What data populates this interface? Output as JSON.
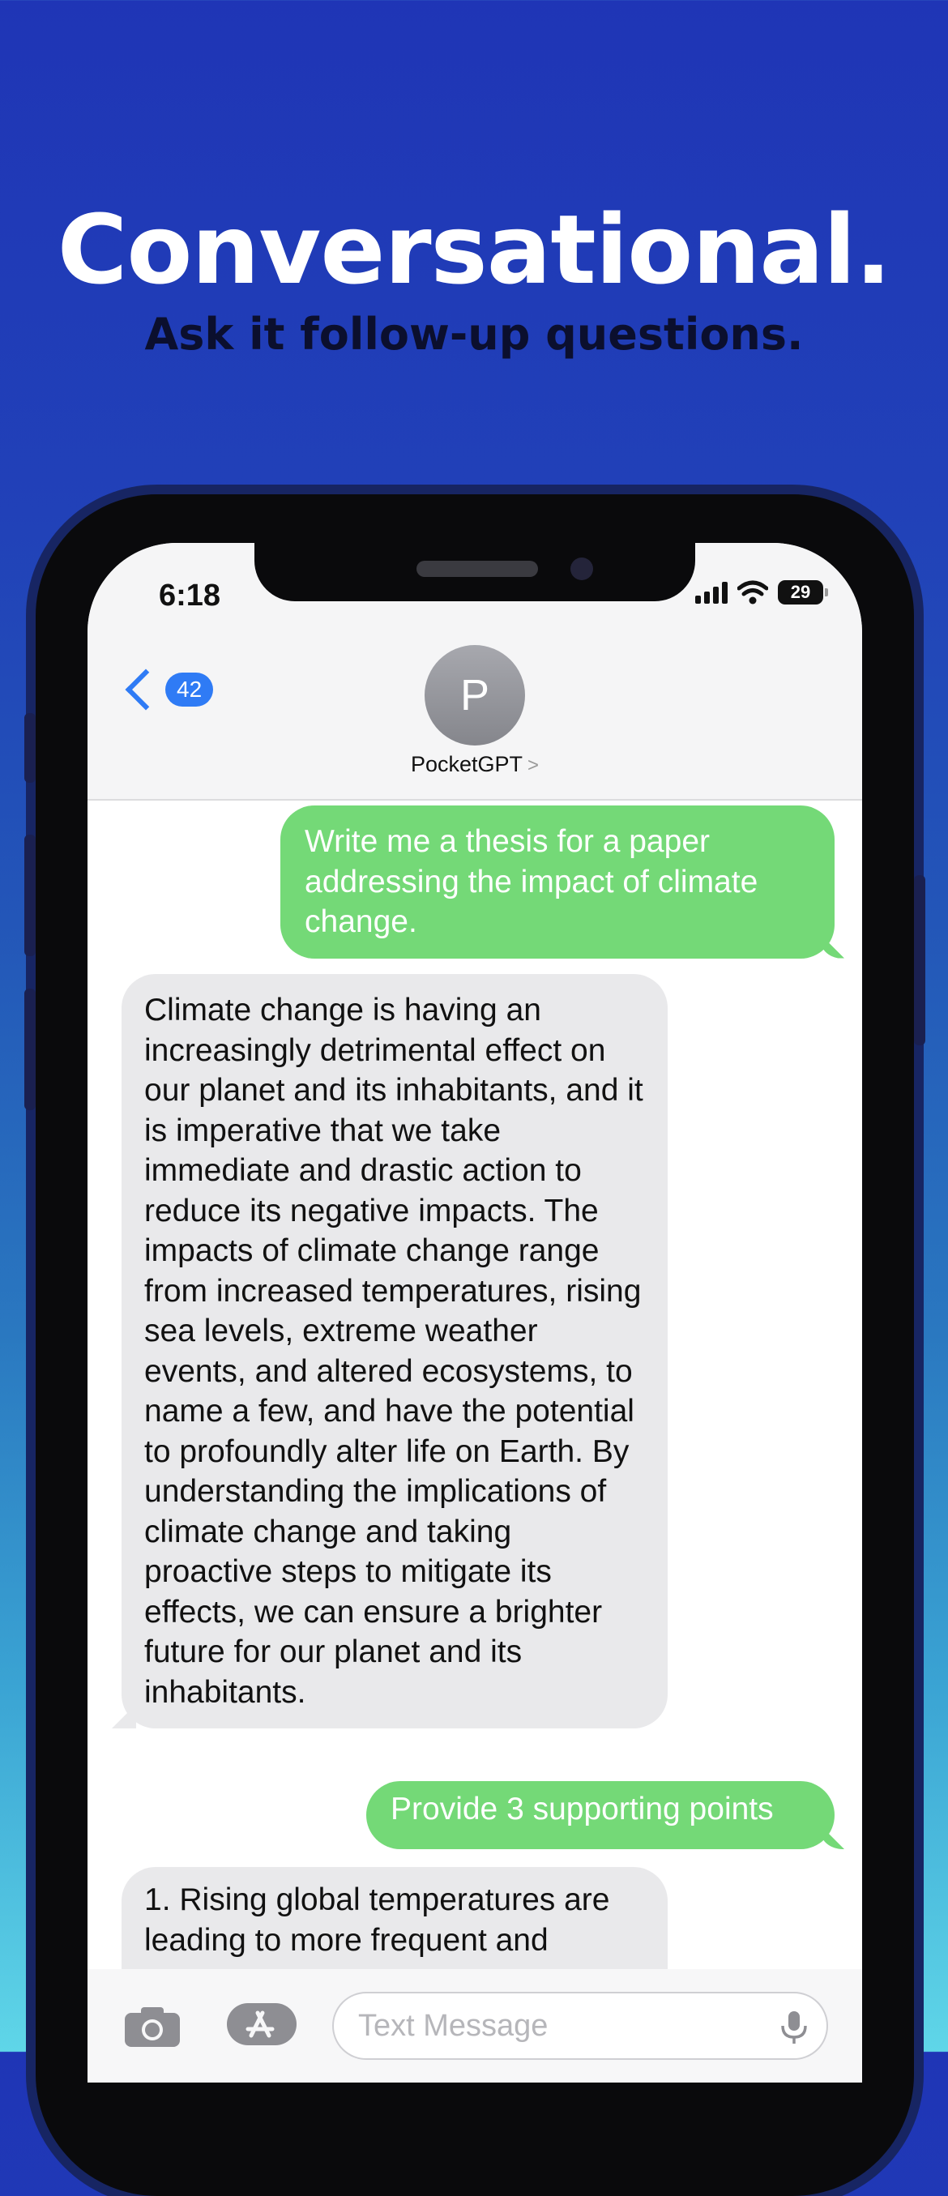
{
  "promo": {
    "headline": "Conversational.",
    "subline": "Ask it follow-up questions."
  },
  "status_bar": {
    "time": "6:18",
    "battery": "29"
  },
  "header": {
    "back_count": "42",
    "avatar_initial": "P",
    "contact_name": "PocketGPT",
    "contact_chevron": ">"
  },
  "messages": [
    {
      "from": "user",
      "text": "Write me a thesis for a paper addressing the impact of climate change."
    },
    {
      "from": "bot",
      "text": "Climate change is having an increasingly detrimental effect on our planet and its inhabitants, and it is imperative that we take immediate and drastic action to reduce its negative impacts. The impacts of climate change range from increased temperatures, rising sea levels, extreme weather events, and altered ecosystems, to name a few, and have the potential to profoundly alter life on Earth. By understanding the implications of climate change and taking proactive steps to mitigate its effects, we can ensure a brighter future for our planet and its inhabitants."
    },
    {
      "from": "user",
      "text": "Provide 3 supporting points"
    },
    {
      "from": "bot",
      "text": "1. Rising global temperatures are leading to more frequent and"
    }
  ],
  "input": {
    "placeholder": "Text Message"
  },
  "colors": {
    "outgoing_bubble": "#74d977",
    "incoming_bubble": "#e9e9eb",
    "accent": "#2f7bf5"
  }
}
